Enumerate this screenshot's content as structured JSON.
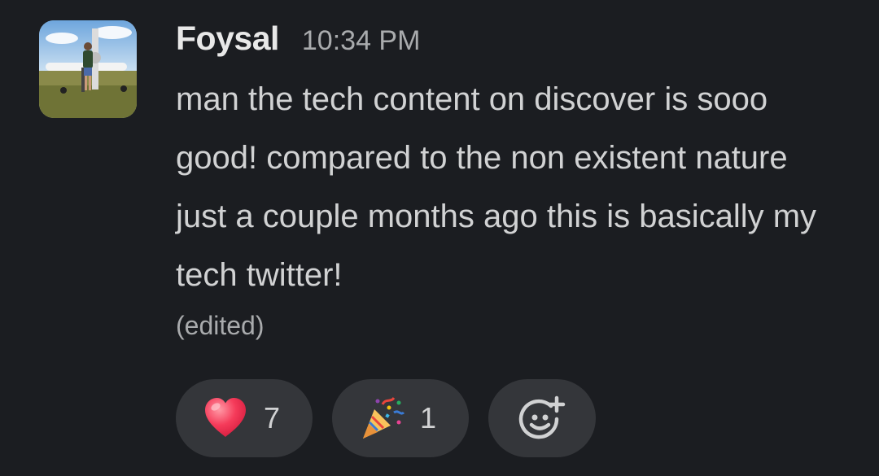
{
  "message": {
    "author": "Foysal",
    "timestamp": "10:34 PM",
    "text": "man the tech content on discover is sooo good! compared to the non existent nature just a couple months ago this is basically my tech twitter!",
    "edited_label": "(edited)"
  },
  "reactions": [
    {
      "emoji": "heart-icon",
      "count": "7"
    },
    {
      "emoji": "party-popper-icon",
      "count": "1"
    }
  ],
  "add_reaction": {
    "icon": "add-reaction-icon"
  },
  "colors": {
    "background": "#1b1d21",
    "pill": "#34363a",
    "text": "#d1d2d3",
    "muted": "#a9abad"
  }
}
